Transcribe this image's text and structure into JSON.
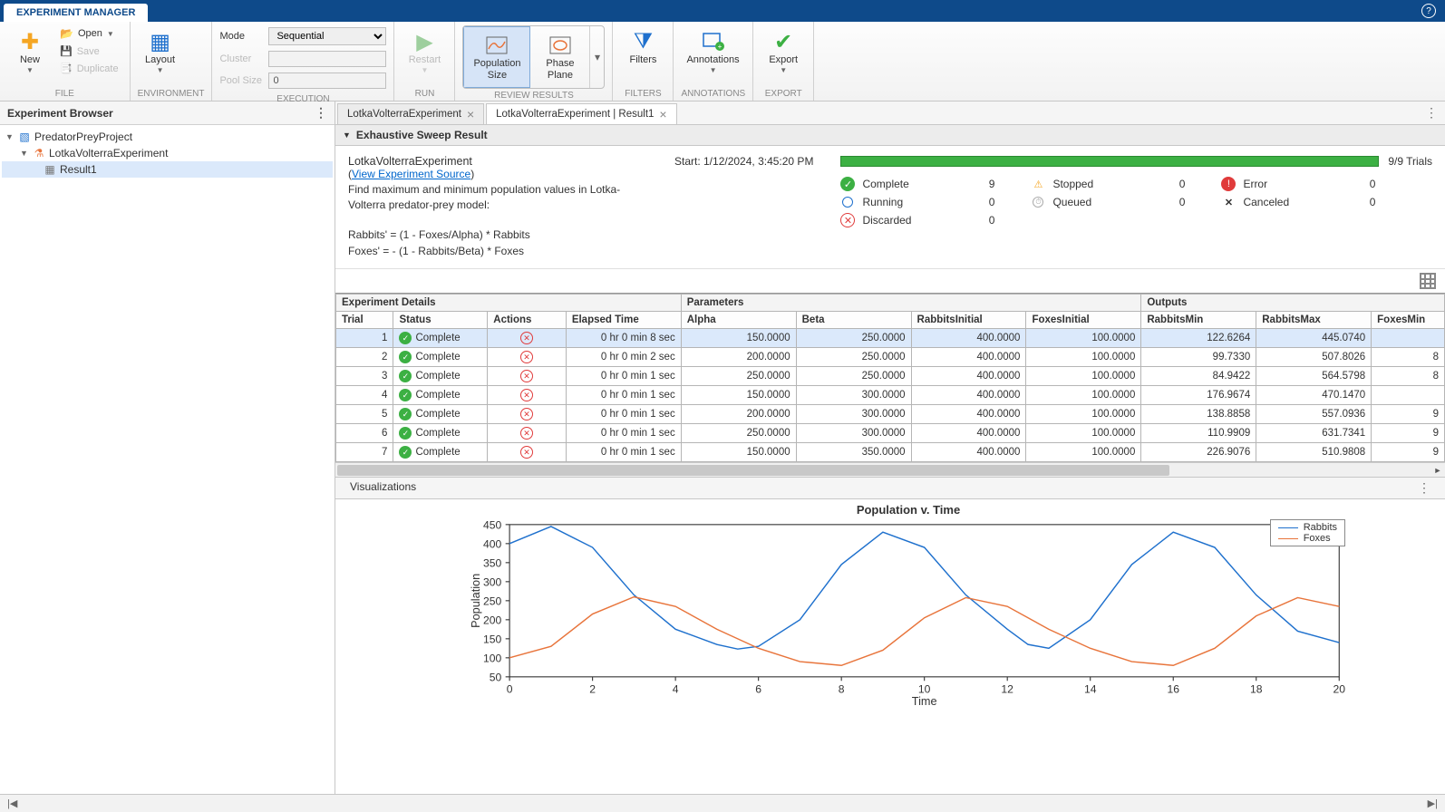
{
  "title_tab": "EXPERIMENT MANAGER",
  "ribbon": {
    "file": {
      "label": "FILE",
      "new": "New",
      "open": "Open",
      "save": "Save",
      "duplicate": "Duplicate"
    },
    "environment": {
      "label": "ENVIRONMENT",
      "layout": "Layout"
    },
    "execution": {
      "label": "EXECUTION",
      "mode_lbl": "Mode",
      "mode_val": "Sequential",
      "cluster_lbl": "Cluster",
      "pool_lbl": "Pool Size",
      "pool_val": "0"
    },
    "run": {
      "label": "RUN",
      "restart": "Restart"
    },
    "review": {
      "label": "REVIEW RESULTS",
      "pop_size": "Population\nSize",
      "phase_plane": "Phase\nPlane"
    },
    "filters": {
      "label": "FILTERS",
      "filters": "Filters"
    },
    "annotations": {
      "label": "ANNOTATIONS",
      "annotations": "Annotations"
    },
    "export": {
      "label": "EXPORT",
      "export": "Export"
    }
  },
  "browser": {
    "title": "Experiment Browser",
    "project": "PredatorPreyProject",
    "experiment": "LotkaVolterraExperiment",
    "result": "Result1"
  },
  "tabs": {
    "t1": "LotkaVolterraExperiment",
    "t2": "LotkaVolterraExperiment | Result1"
  },
  "section": {
    "title": "Exhaustive Sweep Result"
  },
  "summary": {
    "name": "LotkaVolterraExperiment",
    "view_source": "View Experiment Source",
    "desc1": "Find maximum and minimum population values in Lotka-Volterra predator-prey model:",
    "desc2": "Rabbits' = (1 - Foxes/Alpha) * Rabbits",
    "desc3": "Foxes' = - (1 - Rabbits/Beta) * Foxes",
    "start": "Start: 1/12/2024, 3:45:20 PM",
    "trials": "9/9 Trials",
    "statuses": {
      "complete": {
        "label": "Complete",
        "value": "9"
      },
      "stopped": {
        "label": "Stopped",
        "value": "0"
      },
      "error": {
        "label": "Error",
        "value": "0"
      },
      "running": {
        "label": "Running",
        "value": "0"
      },
      "queued": {
        "label": "Queued",
        "value": "0"
      },
      "canceled": {
        "label": "Canceled",
        "value": "0"
      },
      "discarded": {
        "label": "Discarded",
        "value": "0"
      }
    }
  },
  "table": {
    "groups": {
      "details": "Experiment Details",
      "params": "Parameters",
      "outputs": "Outputs"
    },
    "cols": {
      "trial": "Trial",
      "status": "Status",
      "actions": "Actions",
      "elapsed": "Elapsed Time",
      "alpha": "Alpha",
      "beta": "Beta",
      "rabbitsInit": "RabbitsInitial",
      "foxesInit": "FoxesInitial",
      "rabbitsMin": "RabbitsMin",
      "rabbitsMax": "RabbitsMax",
      "foxesMin": "FoxesMin"
    },
    "status_text": "Complete",
    "rows": [
      {
        "trial": "1",
        "elapsed": "0 hr 0 min 8 sec",
        "alpha": "150.0000",
        "beta": "250.0000",
        "ri": "400.0000",
        "fi": "100.0000",
        "rmin": "122.6264",
        "rmax": "445.0740",
        "fmin": ""
      },
      {
        "trial": "2",
        "elapsed": "0 hr 0 min 2 sec",
        "alpha": "200.0000",
        "beta": "250.0000",
        "ri": "400.0000",
        "fi": "100.0000",
        "rmin": "99.7330",
        "rmax": "507.8026",
        "fmin": "8"
      },
      {
        "trial": "3",
        "elapsed": "0 hr 0 min 1 sec",
        "alpha": "250.0000",
        "beta": "250.0000",
        "ri": "400.0000",
        "fi": "100.0000",
        "rmin": "84.9422",
        "rmax": "564.5798",
        "fmin": "8"
      },
      {
        "trial": "4",
        "elapsed": "0 hr 0 min 1 sec",
        "alpha": "150.0000",
        "beta": "300.0000",
        "ri": "400.0000",
        "fi": "100.0000",
        "rmin": "176.9674",
        "rmax": "470.1470",
        "fmin": ""
      },
      {
        "trial": "5",
        "elapsed": "0 hr 0 min 1 sec",
        "alpha": "200.0000",
        "beta": "300.0000",
        "ri": "400.0000",
        "fi": "100.0000",
        "rmin": "138.8858",
        "rmax": "557.0936",
        "fmin": "9"
      },
      {
        "trial": "6",
        "elapsed": "0 hr 0 min 1 sec",
        "alpha": "250.0000",
        "beta": "300.0000",
        "ri": "400.0000",
        "fi": "100.0000",
        "rmin": "110.9909",
        "rmax": "631.7341",
        "fmin": "9"
      },
      {
        "trial": "7",
        "elapsed": "0 hr 0 min 1 sec",
        "alpha": "150.0000",
        "beta": "350.0000",
        "ri": "400.0000",
        "fi": "100.0000",
        "rmin": "226.9076",
        "rmax": "510.9808",
        "fmin": "9"
      }
    ]
  },
  "viz": {
    "header": "Visualizations",
    "title": "Population v. Time",
    "xlabel": "Time",
    "ylabel": "Population",
    "legend": {
      "rabbits": "Rabbits",
      "foxes": "Foxes"
    }
  },
  "chart_data": {
    "type": "line",
    "title": "Population v. Time",
    "xlabel": "Time",
    "ylabel": "Population",
    "xlim": [
      0,
      20
    ],
    "ylim": [
      50,
      450
    ],
    "xticks": [
      0,
      2,
      4,
      6,
      8,
      10,
      12,
      14,
      16,
      18,
      20
    ],
    "yticks": [
      50,
      100,
      150,
      200,
      250,
      300,
      350,
      400,
      450
    ],
    "series": [
      {
        "name": "Rabbits",
        "color": "#1e70cd",
        "x": [
          0,
          1,
          2,
          3,
          4,
          5,
          5.5,
          6,
          7,
          8,
          9,
          10,
          11,
          12,
          12.5,
          13,
          14,
          15,
          16,
          17,
          18,
          19,
          20
        ],
        "y": [
          400,
          445,
          390,
          265,
          175,
          135,
          123,
          130,
          200,
          345,
          430,
          390,
          265,
          175,
          135,
          125,
          200,
          345,
          430,
          390,
          265,
          170,
          140
        ]
      },
      {
        "name": "Foxes",
        "color": "#e8743b",
        "x": [
          0,
          1,
          2,
          3,
          4,
          5,
          6,
          7,
          8,
          9,
          10,
          11,
          12,
          13,
          14,
          15,
          16,
          17,
          18,
          19,
          20
        ],
        "y": [
          100,
          130,
          215,
          260,
          235,
          175,
          125,
          90,
          80,
          120,
          205,
          258,
          235,
          175,
          125,
          90,
          80,
          125,
          210,
          258,
          235
        ]
      }
    ]
  }
}
